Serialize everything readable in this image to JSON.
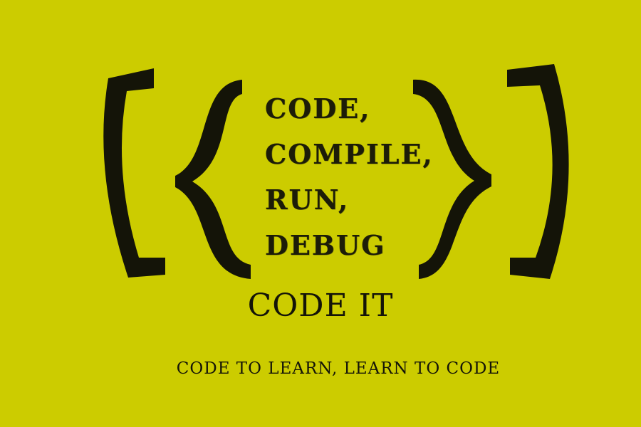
{
  "poster": {
    "background_color": "#cccc00",
    "ink_color": "#141408",
    "stack_lines": [
      "CODE,",
      "COMPILE,",
      "RUN,",
      "DEBUG"
    ],
    "title": "CODE IT",
    "tagline": "CODE TO LEARN, LEARN TO CODE"
  }
}
